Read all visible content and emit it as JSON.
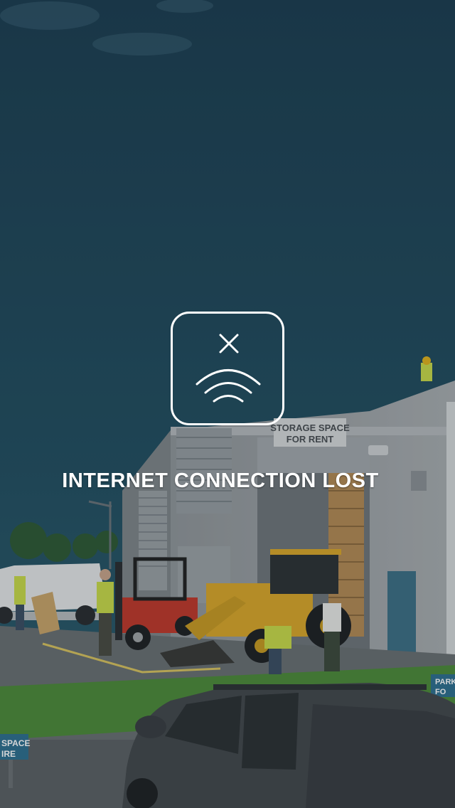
{
  "status": {
    "message": "INTERNET CONNECTION LOST",
    "icon": "no-wifi-icon"
  },
  "background": {
    "signs": {
      "storage": [
        "STORAGE SPACE",
        "FOR RENT"
      ],
      "left_sign": [
        "SPACE",
        "IRE"
      ],
      "right_sign": [
        "PARKI",
        "FO"
      ]
    }
  },
  "colors": {
    "sky_top": "#1e3f52",
    "sky_bottom": "#2a5a6a",
    "message_text": "#ffffff",
    "icon_stroke": "#ffffff",
    "loader_yellow": "#d9a72a",
    "forklift_red": "#c0392b"
  }
}
